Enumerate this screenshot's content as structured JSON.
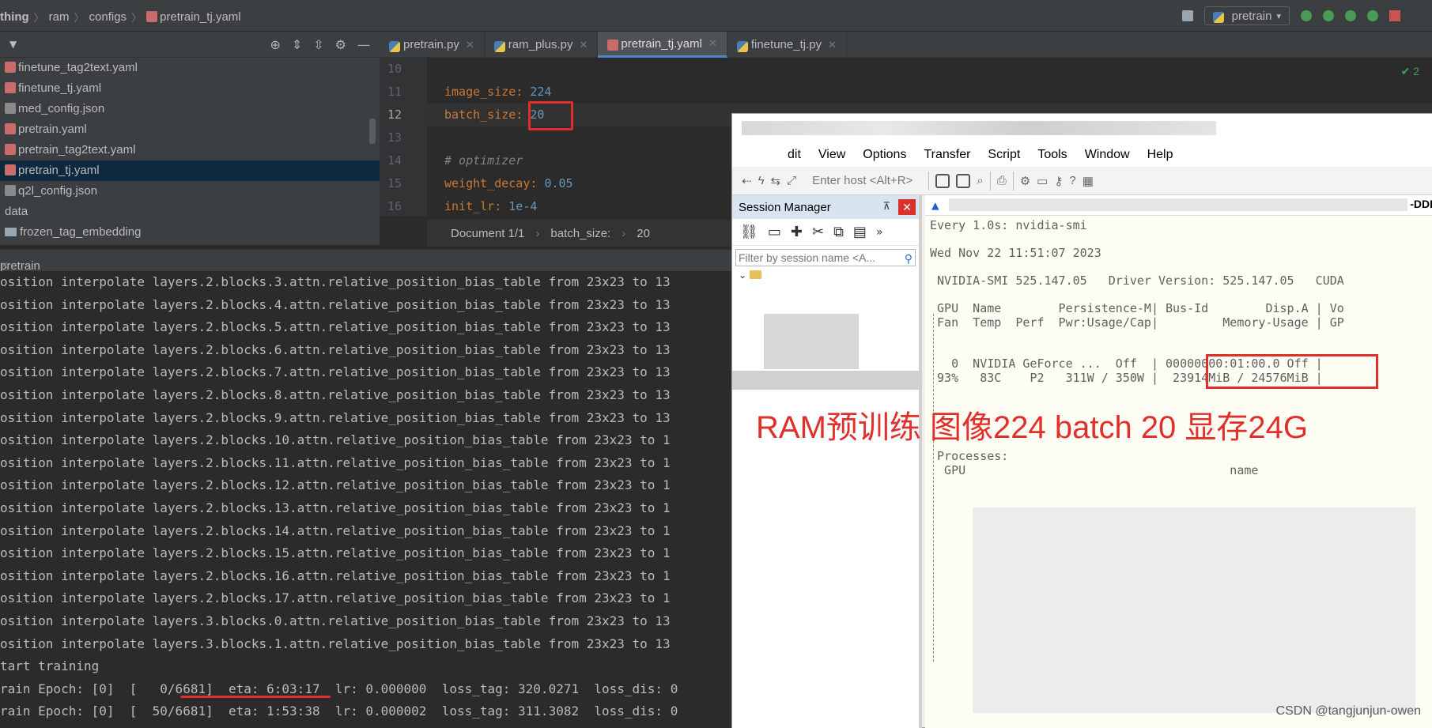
{
  "breadcrumb": [
    "thing",
    "ram",
    "configs",
    "pretrain_tj.yaml"
  ],
  "run_config": "pretrain",
  "project_tree": [
    {
      "name": "finetune_tag2text.yaml",
      "icon": "yaml"
    },
    {
      "name": "finetune_tj.yaml",
      "icon": "yaml"
    },
    {
      "name": "med_config.json",
      "icon": "json"
    },
    {
      "name": "pretrain.yaml",
      "icon": "yaml"
    },
    {
      "name": "pretrain_tag2text.yaml",
      "icon": "yaml"
    },
    {
      "name": "pretrain_tj.yaml",
      "icon": "yaml",
      "selected": true
    },
    {
      "name": "q2l_config.json",
      "icon": "json"
    },
    {
      "name": "data",
      "icon": "none"
    },
    {
      "name": "frozen_tag_embedding",
      "icon": "folder"
    }
  ],
  "editor": {
    "tabs": [
      {
        "label": "pretrain.py",
        "icon": "py"
      },
      {
        "label": "ram_plus.py",
        "icon": "py"
      },
      {
        "label": "pretrain_tj.yaml",
        "icon": "yaml",
        "active": true
      },
      {
        "label": "finetune_tj.py",
        "icon": "py"
      }
    ],
    "line_numbers": [
      "10",
      "11",
      "12",
      "13",
      "14",
      "15",
      "16"
    ],
    "lines": [
      {
        "key": "",
        "value": "",
        "comment": ""
      },
      {
        "key": "image_size:",
        "value": "224",
        "comment": ""
      },
      {
        "key": "batch_size:",
        "value": "20",
        "comment": ""
      },
      {
        "key": "",
        "value": "",
        "comment": ""
      },
      {
        "key": "",
        "value": "",
        "comment": "# optimizer"
      },
      {
        "key": "weight_decay:",
        "value": "0.05",
        "comment": ""
      },
      {
        "key": "init_lr:",
        "value": "1e-4",
        "comment": ""
      }
    ],
    "check_count": "2",
    "status_crumbs": [
      "Document 1/1",
      "batch_size:",
      "20"
    ]
  },
  "run_tab": "pretrain",
  "console_lines": [
    "osition interpolate layers.2.blocks.3.attn.relative_position_bias_table from 23x23 to 13",
    "osition interpolate layers.2.blocks.4.attn.relative_position_bias_table from 23x23 to 13",
    "osition interpolate layers.2.blocks.5.attn.relative_position_bias_table from 23x23 to 13",
    "osition interpolate layers.2.blocks.6.attn.relative_position_bias_table from 23x23 to 13",
    "osition interpolate layers.2.blocks.7.attn.relative_position_bias_table from 23x23 to 13",
    "osition interpolate layers.2.blocks.8.attn.relative_position_bias_table from 23x23 to 13",
    "osition interpolate layers.2.blocks.9.attn.relative_position_bias_table from 23x23 to 13",
    "osition interpolate layers.2.blocks.10.attn.relative_position_bias_table from 23x23 to 1",
    "osition interpolate layers.2.blocks.11.attn.relative_position_bias_table from 23x23 to 1",
    "osition interpolate layers.2.blocks.12.attn.relative_position_bias_table from 23x23 to 1",
    "osition interpolate layers.2.blocks.13.attn.relative_position_bias_table from 23x23 to 1",
    "osition interpolate layers.2.blocks.14.attn.relative_position_bias_table from 23x23 to 1",
    "osition interpolate layers.2.blocks.15.attn.relative_position_bias_table from 23x23 to 1",
    "osition interpolate layers.2.blocks.16.attn.relative_position_bias_table from 23x23 to 1",
    "osition interpolate layers.2.blocks.17.attn.relative_position_bias_table from 23x23 to 1",
    "osition interpolate layers.3.blocks.0.attn.relative_position_bias_table from 23x23 to 13",
    "osition interpolate layers.3.blocks.1.attn.relative_position_bias_table from 23x23 to 13",
    "tart training",
    "rain Epoch: [0]  [   0/6681]  eta: 6:03:17  lr: 0.000000  loss_tag: 320.0271  loss_dis: 0",
    "rain Epoch: [0]  [  50/6681]  eta: 1:53:38  lr: 0.000002  loss_tag: 311.3082  loss_dis: 0"
  ],
  "ssh": {
    "menu": [
      "dit",
      "View",
      "Options",
      "Transfer",
      "Script",
      "Tools",
      "Window",
      "Help"
    ],
    "host_placeholder": "Enter host <Alt+R>",
    "session_manager": {
      "title": "Session Manager",
      "filter_placeholder": "Filter by session name <A..."
    },
    "tab_title_suffix": "-DDI",
    "terminal_lines": [
      "Every 1.0s: nvidia-smi",
      "",
      "Wed Nov 22 11:51:07 2023",
      "",
      " NVIDIA-SMI 525.147.05   Driver Version: 525.147.05   CUDA",
      "",
      " GPU  Name        Persistence-M| Bus-Id        Disp.A | Vo",
      " Fan  Temp  Perf  Pwr:Usage/Cap|         Memory-Usage | GP",
      "",
      "",
      "   0  NVIDIA GeForce ...  Off  | 00000000:01:00.0 Off |",
      " 93%   83C    P2   311W / 350W |  23914MiB / 24576MiB |"
    ],
    "processes_label": " Processes:",
    "processes_header": "  GPU                                     name",
    "annotation": "RAM预训练 图像224  batch 20 显存24G"
  },
  "watermark": "CSDN @tangjunjun-owen",
  "colors": {
    "highlight": "#e22d2d",
    "annotation": "#e0302c"
  }
}
